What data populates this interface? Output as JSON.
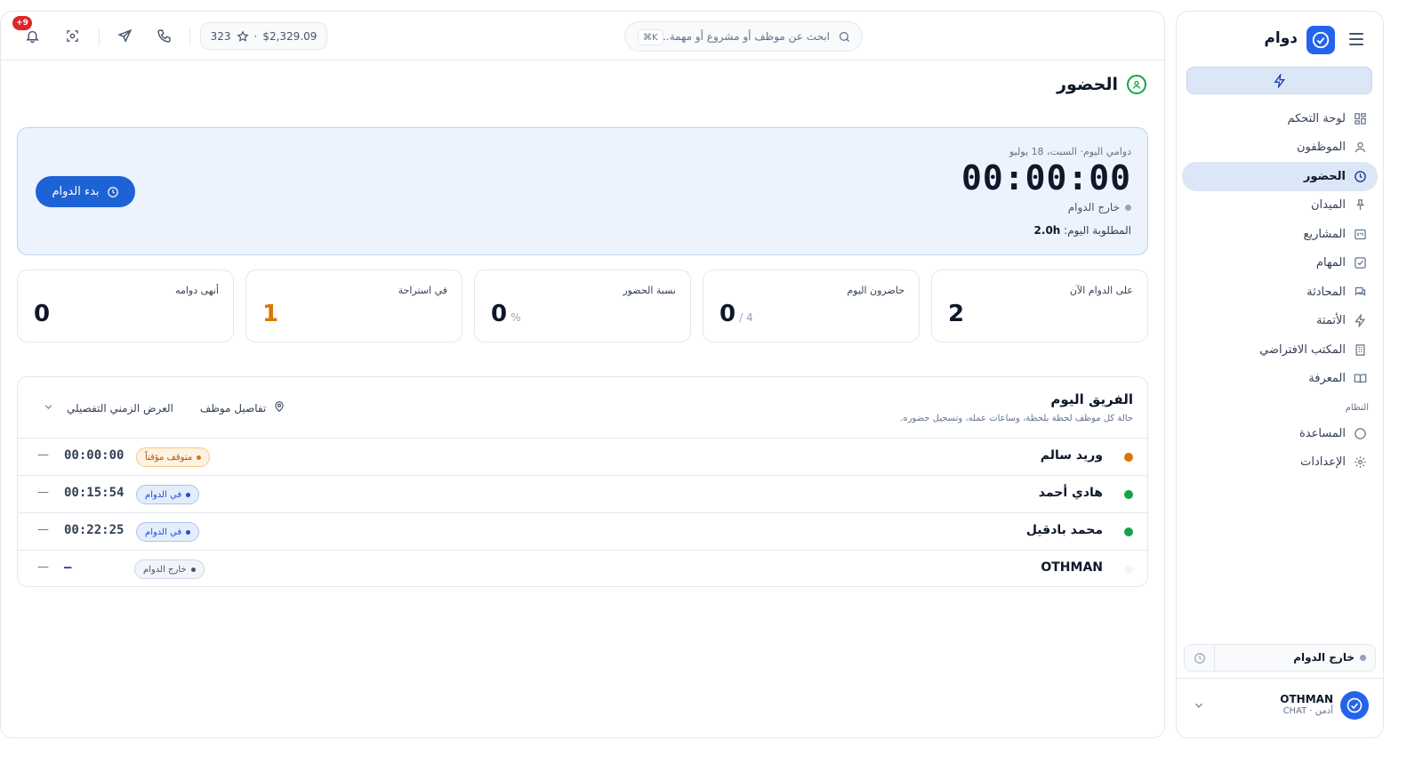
{
  "brand": {
    "name": "دوام",
    "accent": "#2563eb"
  },
  "sidebar": {
    "items": [
      {
        "label": "لوحة التحكم",
        "icon": "dashboard-grid-icon"
      },
      {
        "label": "الموظفون",
        "icon": "user-icon"
      },
      {
        "label": "الحضور",
        "icon": "clock-icon",
        "active": true
      },
      {
        "label": "الميدان",
        "icon": "pin-icon"
      },
      {
        "label": "المشاريع",
        "icon": "kanban-icon"
      },
      {
        "label": "المهام",
        "icon": "checkbox-icon"
      },
      {
        "label": "المحادثة",
        "icon": "chat-icon"
      },
      {
        "label": "الأتمتة",
        "icon": "bolt-icon"
      },
      {
        "label": "المكتب الافتراضي",
        "icon": "building-icon"
      },
      {
        "label": "المعرفة",
        "icon": "book-icon"
      }
    ],
    "system_label": "النظام",
    "system_items": [
      {
        "label": "المساعدة",
        "icon": "help-circle-icon"
      },
      {
        "label": "الإعدادات",
        "icon": "settings-gear-icon"
      }
    ],
    "status_text": "خارج الدوام",
    "user": {
      "name": "OTHMAN",
      "role": "أدمن · CHAT"
    }
  },
  "topbar": {
    "notification_count": "+9",
    "credit": {
      "balance": "$2,329.09",
      "separator": "·",
      "points": "323"
    },
    "search": {
      "placeholder": "ابحث عن موظف أو مشروع أو مهمة...",
      "shortcut": "⌘K"
    }
  },
  "page": {
    "title": "الحضور"
  },
  "shift": {
    "date": "دوامي اليوم· السبت، 18 يوليو",
    "timer": "00:00:00",
    "state": "خارج الدوام",
    "required_label": "المطلوبة اليوم:",
    "required_value": "2.0h",
    "start_button": "بدء الدوام"
  },
  "stats": [
    {
      "label": "على الدوام الآن",
      "value": "2",
      "suffix": ""
    },
    {
      "label": "حاضرون اليوم",
      "value": "0",
      "suffix": "/ 4"
    },
    {
      "label": "نسبة الحضور",
      "value": "0",
      "suffix": "%"
    },
    {
      "label": "في استراحة",
      "value": "1",
      "suffix": "",
      "color": "#d97706"
    },
    {
      "label": "أنهى دوامه",
      "value": "0",
      "suffix": ""
    }
  ],
  "team": {
    "title": "الفريق اليوم",
    "subtitle": "حالة كل موظف لحظة بلحظة، وساعات عمله، وتسجيل حضوره.",
    "employee_details": "تفاصيل موظف",
    "timeline_view": "العرض الزمني التفصيلي",
    "rows": [
      {
        "name": "وريد سالم",
        "status": "متوقف مؤقتاً",
        "time": "00:00:00",
        "status_dot": "#d97706"
      },
      {
        "name": "هادي أحمد",
        "status": "في الدوام",
        "time": "00:15:54",
        "status_dot": "#16a34a"
      },
      {
        "name": "محمد بادقيل",
        "status": "في الدوام",
        "time": "00:22:25",
        "status_dot": "#16a34a"
      },
      {
        "name": "OTHMAN",
        "status": "خارج الدوام",
        "time": "—",
        "status_dot": "#f1f5f9"
      }
    ],
    "row_dash": "—"
  }
}
